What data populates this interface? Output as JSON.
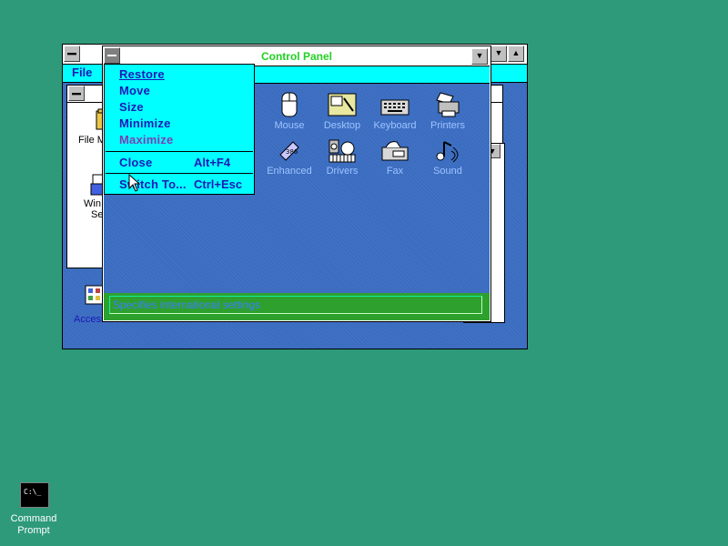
{
  "desktop": {
    "background": "#2e9a79",
    "icons": [
      {
        "label_line1": "Command",
        "label_line2": "Prompt",
        "icon": "command-prompt-icon",
        "glyph": "C:\\_"
      }
    ]
  },
  "program_manager": {
    "menu": {
      "file": "File"
    },
    "group_window": {
      "icons": [
        {
          "label": "File M",
          "icon": "file-manager-icon"
        },
        {
          "label_line1": "Win",
          "label_line2": "Se",
          "icon": "windows-setup-icon"
        }
      ]
    },
    "minimized_group": {
      "label": "Accesso",
      "icon": "accessories-group-icon"
    }
  },
  "control_panel": {
    "title": "Control Panel",
    "icons": [
      {
        "label": "Mouse",
        "icon": "mouse-icon"
      },
      {
        "label": "Desktop",
        "icon": "desktop-icon"
      },
      {
        "label": "Keyboard",
        "icon": "keyboard-icon"
      },
      {
        "label": "Printers",
        "icon": "printers-icon"
      },
      {
        "label": "Enhanced",
        "icon": "enhanced-icon"
      },
      {
        "label": "Drivers",
        "icon": "drivers-icon"
      },
      {
        "label": "Fax",
        "icon": "fax-icon"
      },
      {
        "label": "Sound",
        "icon": "sound-icon"
      }
    ],
    "status": "Specifies international settings"
  },
  "system_menu": {
    "items": [
      {
        "label": "Restore",
        "accel": ""
      },
      {
        "label": "Move",
        "accel": ""
      },
      {
        "label": "Size",
        "accel": ""
      },
      {
        "label": "Minimize",
        "accel": ""
      },
      {
        "label": "Maximize",
        "accel": ""
      },
      {
        "label": "Close",
        "accel": "Alt+F4"
      },
      {
        "label": "Switch To...",
        "accel": "Ctrl+Esc"
      }
    ]
  },
  "colors": {
    "cyan": "#00ffff",
    "window_blue": "#3a6cc0",
    "menu_text": "#1a1ab8",
    "status_text": "#3a7fff"
  }
}
